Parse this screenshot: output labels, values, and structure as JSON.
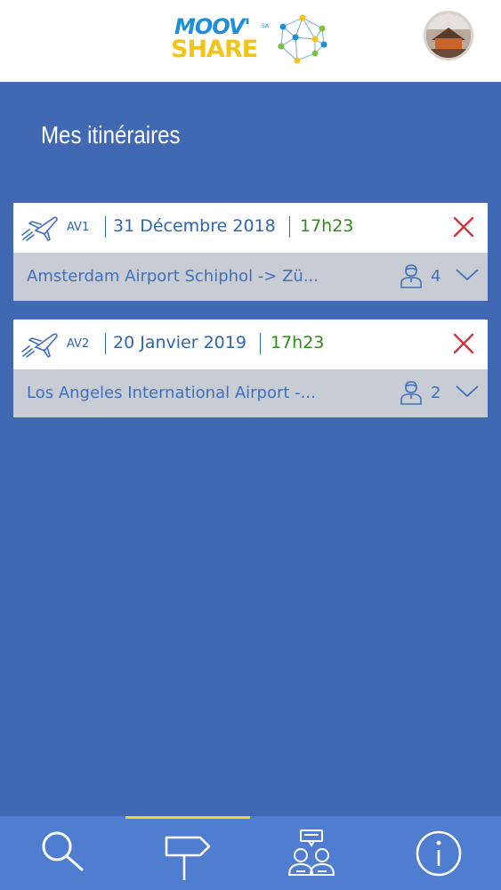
{
  "header": {
    "logo_line1": "MOOV'",
    "logo_line2": "SHARE",
    "logo_small": "SA",
    "logo_icon": "network-globe-icon",
    "avatar_icon": "user-avatar"
  },
  "main": {
    "title": "Mes itinéraires"
  },
  "itineraries": [
    {
      "code": "AV1",
      "date": "31 Décembre 2018",
      "time": "17h23",
      "route": "Amsterdam Airport Schiphol -> Zü...",
      "passengers": "4"
    },
    {
      "code": "AV2",
      "date": "20 Janvier 2019",
      "time": "17h23",
      "route": "Los Angeles International Airport -...",
      "passengers": "2"
    }
  ],
  "tabs": [
    {
      "icon": "search-icon"
    },
    {
      "icon": "signpost-icon",
      "active": true
    },
    {
      "icon": "chat-people-icon"
    },
    {
      "icon": "info-icon"
    }
  ],
  "colors": {
    "background": "#4169b3",
    "tabbar": "#4f7dcf",
    "accent_text": "#2f65b3",
    "time_green": "#2e8b1e",
    "close_red": "#d0343a",
    "active_tab_indicator": "#f2d233"
  }
}
